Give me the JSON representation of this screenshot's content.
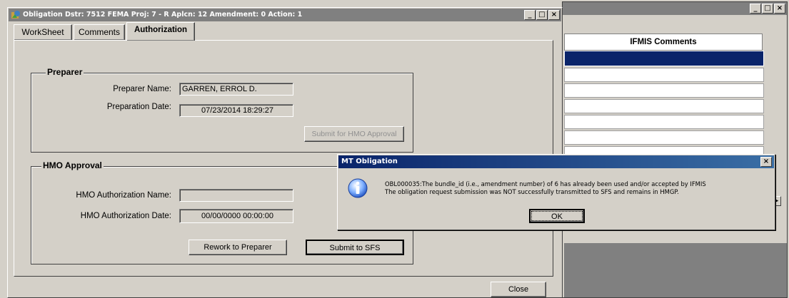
{
  "obligation_window": {
    "title": "Obligation    Dstr: 7512  FEMA Proj: 7 - R  Aplcn: 12  Amendment: 0  Action: 1",
    "tabs": [
      "WorkSheet",
      "Comments",
      "Authorization"
    ],
    "preparer": {
      "legend": "Preparer",
      "name_label": "Preparer Name:",
      "name_value": "GARREN, ERROL D.",
      "date_label": "Preparation Date:",
      "date_value": "07/23/2014 18:29:27",
      "submit_label": "Submit for HMO Approval"
    },
    "hmo": {
      "legend": "HMO Approval",
      "name_label": "HMO Authorization Name:",
      "name_value": "",
      "date_label": "HMO Authorization Date:",
      "date_value": "00/00/0000 00:00:00",
      "rework_label": "Rework to Preparer",
      "submit_sfs_label": "Submit to SFS"
    },
    "close_label": "Close"
  },
  "background_window": {
    "column_header": "IFMIS Comments"
  },
  "dialog": {
    "title": "MT Obligation",
    "message_line1": "OBL000035:The bundle_id (i.e., amendment number) of 6 has already been used and/or accepted by IFMIS",
    "message_line2": "The obligation request submission was NOT successfully transmitted to SFS and remains in HMGP.",
    "ok_label": "OK",
    "icon": "info-icon"
  },
  "window_buttons": {
    "minimize": "_",
    "maximize": "□",
    "close": "×"
  }
}
